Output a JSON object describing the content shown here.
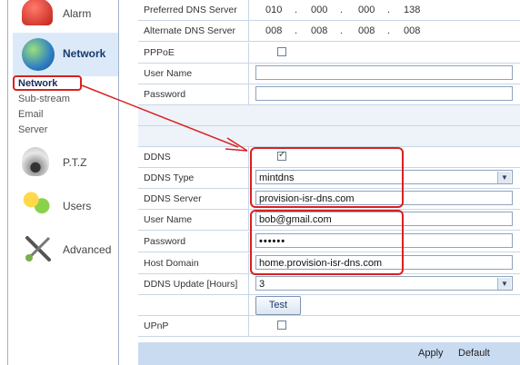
{
  "sidebar": {
    "items": [
      {
        "label": "Alarm",
        "icon": "alarm-icon"
      },
      {
        "label": "Network",
        "icon": "network-globe-icon"
      },
      {
        "label": "P.T.Z",
        "icon": "ptz-camera-icon"
      },
      {
        "label": "Users",
        "icon": "users-icon"
      },
      {
        "label": "Advanced",
        "icon": "tools-icon"
      }
    ],
    "sub_items": [
      "Network",
      "Sub-stream",
      "Email",
      "Server"
    ]
  },
  "form": {
    "preferred_dns": {
      "label": "Preferred DNS Server",
      "octets": [
        "010",
        "000",
        "000",
        "138"
      ]
    },
    "alternate_dns": {
      "label": "Alternate DNS Server",
      "octets": [
        "008",
        "008",
        "008",
        "008"
      ]
    },
    "pppoe": {
      "label": "PPPoE",
      "checked": false
    },
    "pppoe_user": {
      "label": "User Name",
      "value": ""
    },
    "pppoe_password": {
      "label": "Password",
      "value": ""
    },
    "ddns": {
      "label": "DDNS",
      "checked": true
    },
    "ddns_type": {
      "label": "DDNS Type",
      "value": "mintdns"
    },
    "ddns_server": {
      "label": "DDNS Server",
      "value": "provision-isr-dns.com"
    },
    "ddns_user": {
      "label": "User Name",
      "value": "bob@gmail.com"
    },
    "ddns_password": {
      "label": "Password",
      "value": "••••••"
    },
    "host_domain": {
      "label": "Host Domain",
      "value": "home.provision-isr-dns.com"
    },
    "ddns_update": {
      "label": "DDNS Update [Hours]",
      "value": "3"
    },
    "test_button": "Test",
    "upnp": {
      "label": "UPnP",
      "checked": false
    }
  },
  "footer": {
    "apply": "Apply",
    "default": "Default"
  },
  "colors": {
    "highlight": "#d92020",
    "row_border": "#c9d6e6",
    "footer_bg": "#c9dbf0"
  }
}
